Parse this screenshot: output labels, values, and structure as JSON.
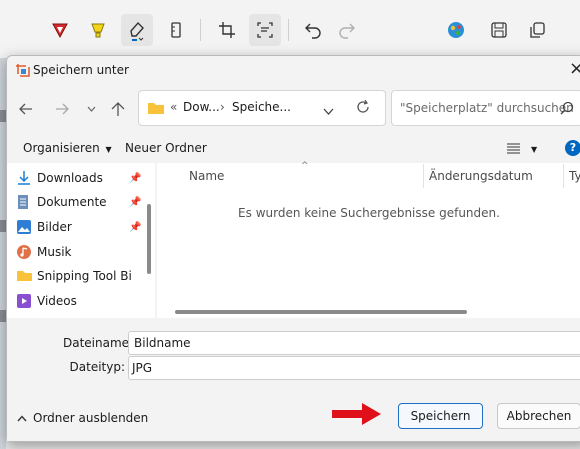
{
  "colors": {
    "accent": "#0067c0",
    "arrow": "#e0101a",
    "folder": "#f8c23a"
  },
  "toolbar": {
    "icons": [
      "pen-red-icon",
      "highlighter-icon",
      "eraser-icon",
      "ruler-icon",
      "crop-icon",
      "text-actions-icon",
      "undo-icon",
      "redo-icon",
      "paint-icon",
      "save-icon",
      "copy-icon"
    ]
  },
  "dialog": {
    "title": "Speichern unter",
    "close": "×",
    "address": {
      "prefix": "«",
      "seg1": "Dow...",
      "sep": "›",
      "seg2": "Speiche..."
    },
    "search_placeholder": "\"Speicherplatz\" durchsuchen",
    "organize": "Organisieren",
    "new_folder": "Neuer Ordner",
    "sidebar": [
      {
        "label": "Downloads",
        "pinned": true,
        "icon": "download-icon"
      },
      {
        "label": "Dokumente",
        "pinned": true,
        "icon": "document-icon"
      },
      {
        "label": "Bilder",
        "pinned": true,
        "icon": "pictures-icon"
      },
      {
        "label": "Musik",
        "pinned": false,
        "icon": "music-icon"
      },
      {
        "label": "Snipping Tool Bi",
        "pinned": false,
        "icon": "folder-icon"
      },
      {
        "label": "Videos",
        "pinned": false,
        "icon": "video-icon"
      }
    ],
    "columns": {
      "name": "Name",
      "date": "Änderungsdatum",
      "type": "Typ"
    },
    "empty_message": "Es wurden keine Suchergebnisse gefunden.",
    "filename_label": "Dateiname:",
    "filename_value": "Bildname",
    "filetype_label": "Dateityp:",
    "filetype_value": "JPG",
    "hide_folders": "Ordner ausblenden",
    "save": "Speichern",
    "cancel": "Abbrechen",
    "help": "?"
  }
}
